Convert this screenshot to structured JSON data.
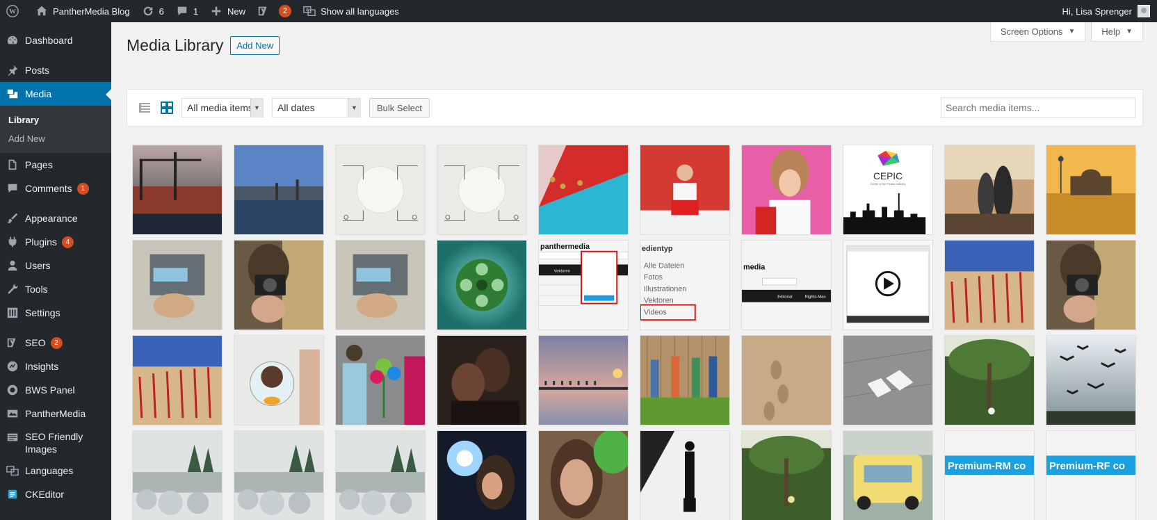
{
  "adminbar": {
    "site_name": "PantherMedia Blog",
    "updates_count": "6",
    "comments_count": "1",
    "new_label": "New",
    "seo_count": "2",
    "languages_label": "Show all languages",
    "greeting": "Hi, Lisa Sprenger"
  },
  "sidebar": {
    "dashboard": "Dashboard",
    "posts": "Posts",
    "media": "Media",
    "library": "Library",
    "add_new": "Add New",
    "pages": "Pages",
    "comments": "Comments",
    "comments_count": "1",
    "appearance": "Appearance",
    "plugins": "Plugins",
    "plugins_count": "4",
    "users": "Users",
    "tools": "Tools",
    "settings": "Settings",
    "seo": "SEO",
    "seo_count": "2",
    "insights": "Insights",
    "bws_panel": "BWS Panel",
    "panthermedia": "PantherMedia",
    "seo_friendly_1": "SEO Friendly",
    "seo_friendly_2": "Images",
    "languages": "Languages",
    "ckeditor": "CKEditor"
  },
  "screen_meta": {
    "screen_options": "Screen Options",
    "help": "Help"
  },
  "page": {
    "title": "Media Library",
    "add_new": "Add New"
  },
  "toolbar": {
    "filter_type": "All media items",
    "filter_date": "All dates",
    "bulk_select": "Bulk Select",
    "search_placeholder": "Search media items..."
  },
  "thumb_text": {
    "cepic": "CEPIC",
    "cepic_sub": "Centre of the Picture Industry",
    "pm_brand": "panthermedia",
    "pm_brand_short": "media",
    "vektoren": "Vektoren",
    "editorial": "Editorial",
    "rights_managed": "Rights-Man",
    "mediatype_title": "edientyp",
    "mt_all": "Alle Dateien",
    "mt_photos": "Fotos",
    "mt_illus": "Illustrationen",
    "mt_vectors": "Vektoren",
    "mt_videos": "Videos",
    "premium_rm": "Premium-RM co",
    "premium_rf": "Premium-RF co"
  },
  "colors": {
    "admin_dark": "#23282d",
    "wp_blue": "#0073aa",
    "badge_orange": "#d54e21",
    "premium_blue": "#1ba1e2"
  }
}
